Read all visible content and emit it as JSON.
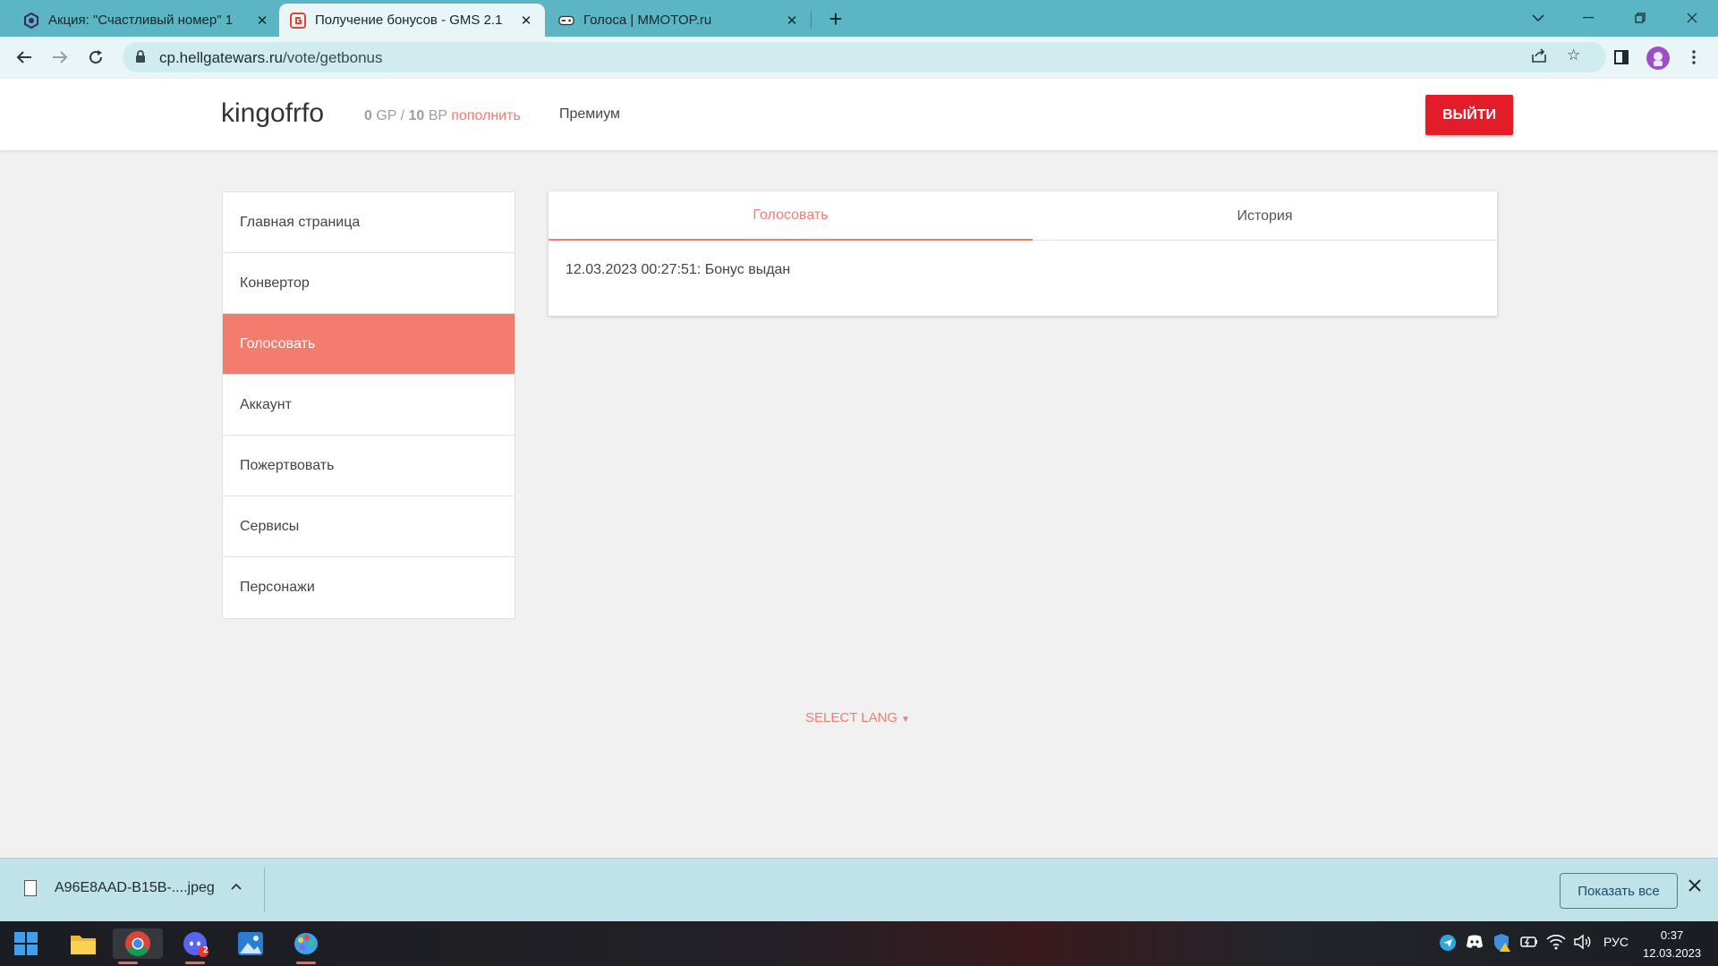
{
  "browser": {
    "tabs": [
      {
        "title": "Акция: \"Счастливый номер\" 1 ",
        "icon": "hexagon-game-icon",
        "active": false
      },
      {
        "title": "Получение бонусов - GMS 2.1",
        "icon": "gms-logo-icon",
        "active": true
      },
      {
        "title": "Голоса | MMOTOP.ru",
        "icon": "mmotop-gamepad-icon",
        "active": false
      }
    ],
    "url_host": "cp.hellgatewars.ru",
    "url_path": "/vote/getbonus"
  },
  "header": {
    "username": "kingofrfo",
    "gp_value": "0",
    "gp_unit": " GP / ",
    "bp_value": "10",
    "bp_unit": " BP ",
    "topup_label": "пополнить",
    "premium_label": "Премиум",
    "logout_label": "ВЫЙТИ"
  },
  "sidebar": {
    "items": [
      {
        "label": "Главная страница",
        "active": false
      },
      {
        "label": "Конвертор",
        "active": false
      },
      {
        "label": "Голосовать",
        "active": true
      },
      {
        "label": "Аккаунт",
        "active": false
      },
      {
        "label": "Пожертвовать",
        "active": false
      },
      {
        "label": "Сервисы",
        "active": false
      },
      {
        "label": "Персонажи",
        "active": false
      }
    ]
  },
  "content": {
    "tabs": [
      {
        "label": "Голосовать",
        "active": true
      },
      {
        "label": "История",
        "active": false
      }
    ],
    "message": "12.03.2023 00:27:51: Бонус выдан"
  },
  "footer": {
    "lang_label": "SELECT LANG"
  },
  "downloads": {
    "file_name": "A96E8AAD-B15B-....jpeg",
    "show_all_label": "Показать все"
  },
  "taskbar": {
    "language": "РУС",
    "time": "0:37",
    "date": "12.03.2023",
    "discord_badge": "2"
  },
  "colors": {
    "accent": "#f47c6e",
    "logout": "#e21d27",
    "chrome_frame": "#5bb5c2"
  }
}
